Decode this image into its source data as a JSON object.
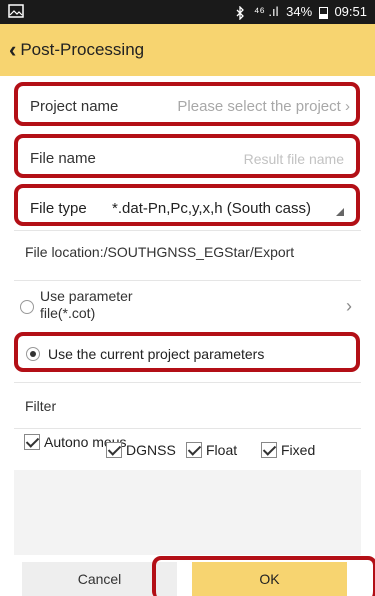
{
  "status_bar": {
    "signal_text": "⁴⁶ .ıl",
    "battery": "34%",
    "time": "09:51"
  },
  "header": {
    "title": "Post-Processing"
  },
  "form": {
    "project_name": {
      "label": "Project name",
      "value": "Please select the project"
    },
    "file_name": {
      "label": "File name",
      "placeholder": "Result file name"
    },
    "file_type": {
      "label": "File type",
      "value": "*.dat-Pn,Pc,y,x,h (South cass)"
    },
    "file_location": "File location:/SOUTHGNSS_EGStar/Export"
  },
  "params": {
    "use_param_file": "Use parameter file(*.cot)",
    "use_current": "Use the current project parameters"
  },
  "filter": {
    "label": "Filter",
    "options": [
      {
        "label": "Autono mous",
        "checked": true
      },
      {
        "label": "DGNSS",
        "checked": true
      },
      {
        "label": "Float",
        "checked": true
      },
      {
        "label": "Fixed",
        "checked": true
      }
    ]
  },
  "buttons": {
    "cancel": "Cancel",
    "ok": "OK"
  },
  "colors": {
    "accent": "#f7d470",
    "highlight": "#b30f16"
  }
}
